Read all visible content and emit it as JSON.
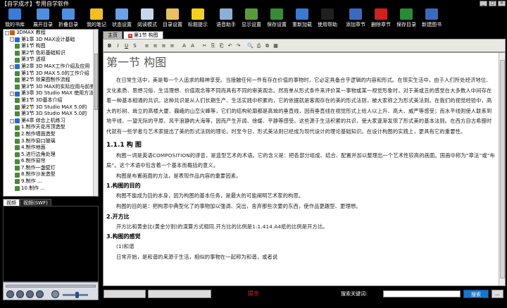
{
  "window": {
    "title": "【自学成才】专用自学软件"
  },
  "toolbar": [
    {
      "label": "我的书库",
      "color": "#3b7ad6"
    },
    {
      "label": "展开目录",
      "color": "#4f8fe0"
    },
    {
      "label": "折叠目录",
      "color": "#4f8fe0"
    },
    {
      "label": "我的笔记",
      "color": "#f0c020"
    },
    {
      "label": "状态设置",
      "color": "#6aa2e8"
    },
    {
      "label": "阅读模式",
      "color": "#c8d6f0"
    },
    {
      "label": "目录设置",
      "color": "#e8c060"
    },
    {
      "label": "标题提示",
      "color": "#f2d020"
    },
    {
      "label": "语音助手",
      "color": "#8ab0d8"
    },
    {
      "label": "显示设置",
      "color": "#5a9a3a"
    },
    {
      "label": "保存设置",
      "color": "#3a8a3a"
    },
    {
      "label": "重新加载",
      "color": "#3a7ad0"
    },
    {
      "label": "使用帮助",
      "color": "#202020"
    },
    {
      "label": "添加章节",
      "color": "#3a6ac0"
    },
    {
      "label": "删除章节",
      "color": "#d02020"
    },
    {
      "label": "保存目录",
      "color": "#2a8a3a"
    },
    {
      "label": "新建图书",
      "color": "#3a6ac0"
    }
  ],
  "tree": [
    {
      "indent": 0,
      "exp": "-",
      "label": "3DMAX 教程"
    },
    {
      "indent": 1,
      "exp": "-",
      "label": "第1章 3D MAX设计基础"
    },
    {
      "indent": 2,
      "exp": "",
      "label": "第1节 构图"
    },
    {
      "indent": 2,
      "exp": "",
      "label": "第2节 色彩基础知识"
    },
    {
      "indent": 2,
      "exp": "",
      "label": "第3节 透视"
    },
    {
      "indent": 1,
      "exp": "-",
      "label": "第2章 3D MAX工作介绍及应用"
    },
    {
      "indent": 2,
      "exp": "",
      "label": "第1节 3D MAX 5.0的工作介绍"
    },
    {
      "indent": 2,
      "exp": "",
      "label": "第2节 效果图制作流程"
    },
    {
      "indent": 2,
      "exp": "",
      "label": "第3节 3D MAX的实际应用与前景"
    },
    {
      "indent": 1,
      "exp": "-",
      "label": "第3章 3D Studio MAX 使用方法"
    },
    {
      "indent": 2,
      "exp": "",
      "label": "第1节 3D基本介绍"
    },
    {
      "indent": 2,
      "exp": "",
      "label": "第2节 3D Studio MAX 5.0的"
    },
    {
      "indent": 2,
      "exp": "",
      "label": "第3节 3D Studio MAX 5.0的"
    },
    {
      "indent": 1,
      "exp": "-",
      "label": "第4章 综合上机练习"
    },
    {
      "indent": 2,
      "exp": "",
      "label": "1.制作天花吊顶造型"
    },
    {
      "indent": 2,
      "exp": "",
      "label": "2.制作墙面造型"
    },
    {
      "indent": 2,
      "exp": "",
      "label": "3.制作窗口玻璃"
    },
    {
      "indent": 2,
      "exp": "",
      "label": "4.制作地面"
    },
    {
      "indent": 2,
      "exp": "",
      "label": "5.进行边角处理"
    },
    {
      "indent": 2,
      "exp": "",
      "label": "6.制作窗帘"
    },
    {
      "indent": 2,
      "exp": "",
      "label": "7.制作一盏壁灯"
    },
    {
      "indent": 2,
      "exp": "",
      "label": "8.制作沙发造型"
    },
    {
      "indent": 2,
      "exp": "",
      "label": "9.制作 ..."
    },
    {
      "indent": 2,
      "exp": "",
      "label": "10.制作 ..."
    }
  ],
  "video_tabs": [
    "视频",
    "视频(SWF)"
  ],
  "doc_tabs": [
    "主页",
    "第1节 构图"
  ],
  "editor_buttons": [
    "B",
    "I",
    "U",
    "S",
    "≡",
    "≡",
    "≡",
    "≡",
    "A",
    "A",
    "✂",
    "⎘",
    "⎗",
    "↶",
    "↷",
    "🔍",
    "⎙",
    "⧉",
    "▦"
  ],
  "doc": {
    "title": "第一节 构图",
    "para1": "在日常生活中，美是每一个人追求的精神享受。当接触任何一件有存在价值的事物时，它必定具备合乎逻辑的内容和形式。在现实生活中，由于人们所处经济地位、文化素质、思想习俗、生活理想、价值观念等不同而具有不同的审美观念。然而单从形式条件来评价某一事物或某一视觉形象时，对于美或丑的感觉在大多数人中间存在着一种基本相通的共识。这种共识是从人们长期生产、生活实践中积累的，它的依据就是客观存在的美的形式法则，被大家称之为形式美法则。在我们的视觉经验中，高大的杉树、耸立的高楼大厦、巍峨的山峦尖峰等，它们的结构轮廓都是高耸的垂直线，因而垂直线在视觉形式上给人以上升、高大、威严等感受；而水平线则使人联系到地平线、一望无际的平原、风平浪静的大海等，因而产生开阔、徐缓、平静等感受。这些源于生活积累的共识，使大家逐渐发现了形式美的基本法则。在西方自古希腊时代就有一些学者与艺术家提出了美的形式法则的理论，时至今日，形式美法则已经成为现代设计的理论基础知识。在设计构图的实践上，更具有它的重要性。",
    "h_1_1": "1.1.1 构 图",
    "para2": "构图一词是英语COMPOSITION的译音，是造型艺术的术语。它的含义是：把各部分组成、结合、配置并加以整理出一个艺术性较高的画面。国画中称为“章法”或“布局”。这个术语中包含着一个基本而概括的意义。",
    "para3": "构图是布置画面的方法，是表现作品内容的重要因素。",
    "h_purpose": "1.构图的目的",
    "para4": "构图不能成为目的本身，因为构图的基本任务，是最大的可能阐明艺术家的构思。",
    "para5": "构图的目的是：把构思中典型化了的事物加以强调、突出，舍弃那些次要的东西，使作品更趣型、更理想。",
    "h_ratio": "2.开方比",
    "para6": "开方比和黄金比(黄金分割)的演算方式相同.开方比的比例是1:1.414.A4纸的比例是开方比。",
    "h_feel": "3.构图的感觉",
    "para7": "(1)和谐",
    "para8": "日常开始，是和谐的来源于生活，相似的事物在一起称为和谐，或者说"
  },
  "bottom": {
    "hint": "提示",
    "search_label": "搜索关键词:",
    "search_value": "",
    "search_button": "搜索",
    "extra_button": "..."
  }
}
